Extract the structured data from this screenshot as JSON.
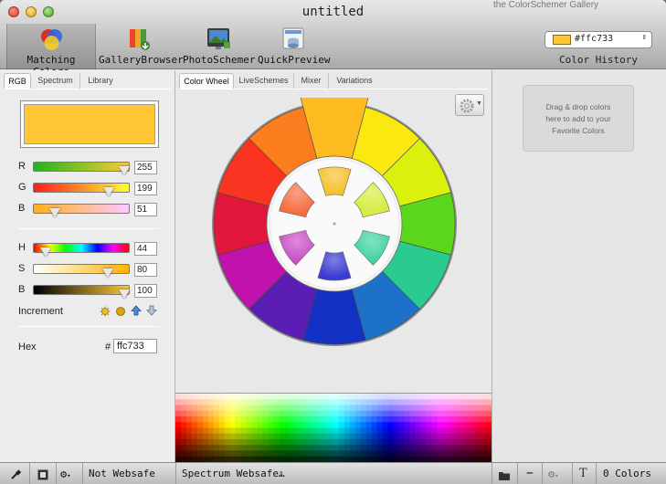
{
  "window": {
    "title": "untitled",
    "background_title": "the ColorSchemer Gallery"
  },
  "toolbar": {
    "items": [
      {
        "label": "Matching Colors",
        "icon": "matching-colors-icon",
        "active": true
      },
      {
        "label": "GalleryBrowser",
        "icon": "gallery-browser-icon",
        "active": false
      },
      {
        "label": "PhotoSchemer",
        "icon": "photo-schemer-icon",
        "active": false
      },
      {
        "label": "QuickPreview",
        "icon": "quick-preview-icon",
        "active": false
      }
    ],
    "history": {
      "selected": "#ffc733",
      "label": "Color History",
      "color": "#ffc733"
    }
  },
  "left_panel": {
    "tabs": [
      "RGB",
      "Spectrum",
      "Library"
    ],
    "selected_tab": "RGB",
    "current_color": "#ffc733",
    "rgb": [
      {
        "label": "R",
        "value": "255",
        "fraction": 1.0
      },
      {
        "label": "G",
        "value": "199",
        "fraction": 0.78
      },
      {
        "label": "B",
        "value": "51",
        "fraction": 0.2
      }
    ],
    "hsb": [
      {
        "label": "H",
        "value": "44",
        "fraction": 0.122
      },
      {
        "label": "S",
        "value": "80",
        "fraction": 0.8
      },
      {
        "label": "B",
        "value": "100",
        "fraction": 1.0
      }
    ],
    "increment_label": "Increment",
    "increment_icons": [
      "brighter-icon",
      "darker-icon",
      "up-arrow-icon",
      "down-arrow-icon"
    ],
    "hex_label": "Hex",
    "hex_prefix": "#",
    "hex_value": "ffc733"
  },
  "center_panel": {
    "tabs": [
      "Color Wheel",
      "LiveSchemes",
      "Mixer",
      "Variations"
    ],
    "selected_tab": "Color Wheel",
    "wheel_colors": [
      "#fdbb1f",
      "#fbe80f",
      "#daf00d",
      "#5ad71a",
      "#2acb8f",
      "#1d71c9",
      "#1331c2",
      "#5a1eb5",
      "#c112ad",
      "#e0173a",
      "#f93522",
      "#fb7d1d"
    ],
    "selected_index": 0,
    "inner_colors": [
      "#f5c12c",
      "#d8ec3f",
      "#3fd3a0",
      "#3b3bd3",
      "#c94ec5",
      "#f56d3f"
    ],
    "gear_icon": "gear-icon"
  },
  "right_panel": {
    "favorites_text": [
      "Drag & drop colors",
      "here to add to your",
      "Favorite Colors"
    ]
  },
  "bottom_bar": {
    "websafe_status": "Not Websafe",
    "palette_select": "Spectrum Websafe…",
    "color_count": "0 Colors",
    "icons": [
      "eyedropper-icon",
      "picker-icon",
      "action-gear-icon",
      "folder-icon",
      "minus-icon",
      "settings-gear-icon",
      "text-icon"
    ]
  }
}
